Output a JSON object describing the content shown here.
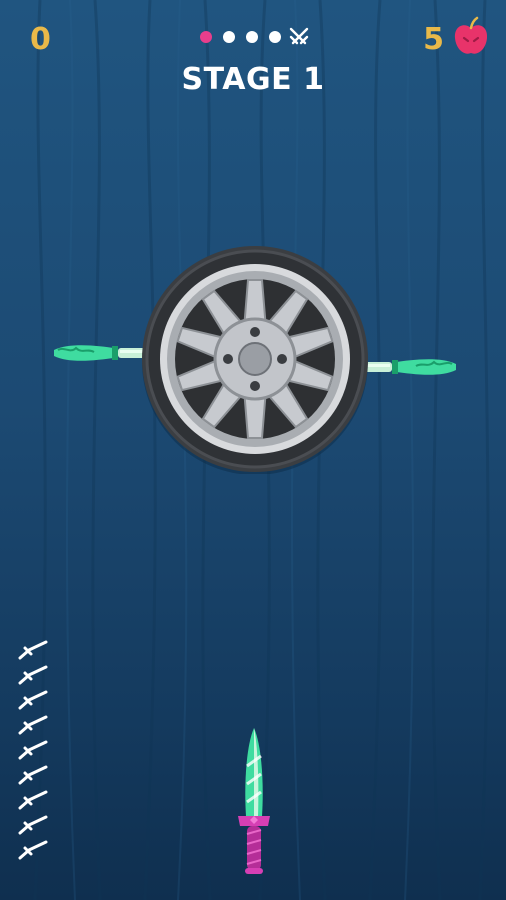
{
  "hud": {
    "score": "0",
    "apples": "5",
    "stage_title": "STAGE 1",
    "stage_progress": {
      "total_stages": 5,
      "current_stage": 1,
      "boss_icon": "crossed-swords-icon"
    }
  },
  "game": {
    "target": "wheel",
    "stuck_knives": 2,
    "knives_remaining": 9,
    "colors": {
      "score": "#e9b949",
      "active_dot": "#e83e8c",
      "knife_blade": "#3fdca0",
      "knife_handle": "#d63fb4"
    }
  }
}
